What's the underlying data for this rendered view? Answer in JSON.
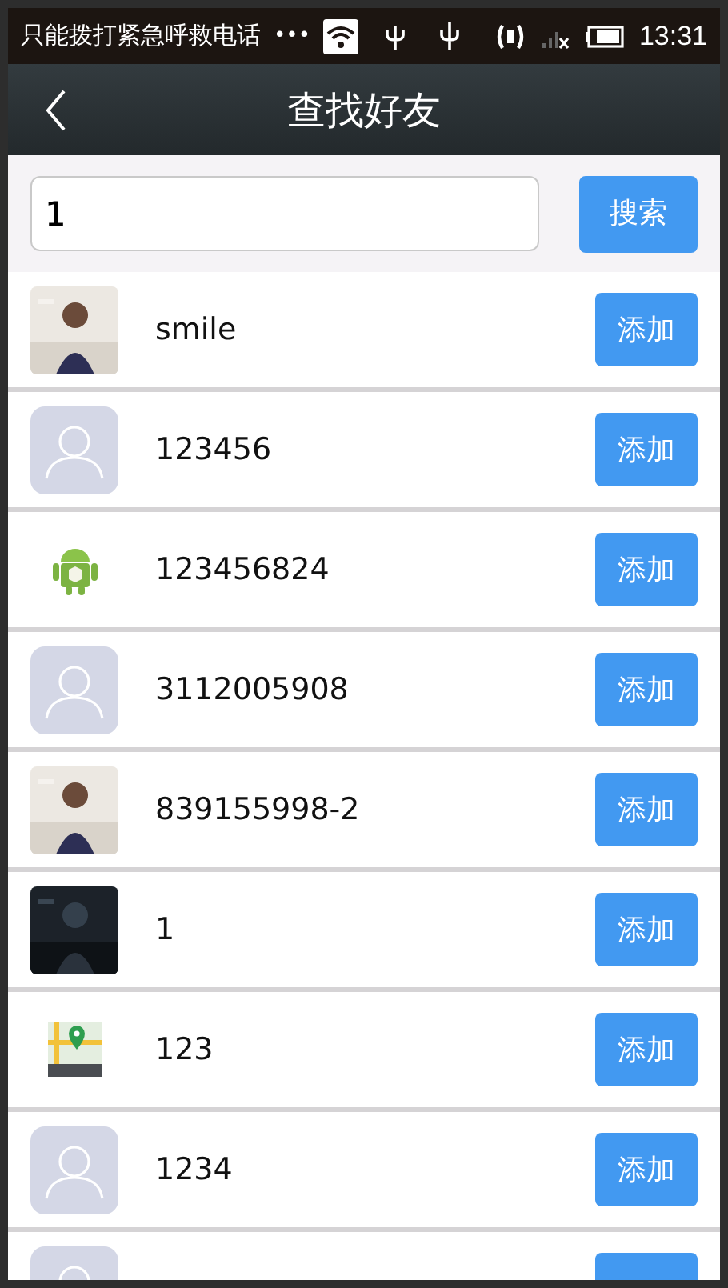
{
  "status_bar": {
    "carrier": "只能拨打紧急呼救电话",
    "more": "•••",
    "time": "13:31"
  },
  "header": {
    "title": "查找好友"
  },
  "search": {
    "value": "1",
    "button": "搜索"
  },
  "results": [
    {
      "name": "smile",
      "button": "添加"
    },
    {
      "kind": "default",
      "name": "123456",
      "button": "添加"
    },
    {
      "kind": "android",
      "name": "123456824",
      "button": "添加"
    },
    {
      "kind": "default",
      "name": "3112005908",
      "button": "添加"
    },
    {
      "name": "839155998-2",
      "button": "添加"
    },
    {
      "name": "1",
      "button": "添加"
    },
    {
      "kind": "map",
      "name": "123",
      "button": "添加"
    },
    {
      "kind": "default",
      "name": "1234",
      "button": "添加"
    },
    {
      "kind": "default"
    }
  ]
}
